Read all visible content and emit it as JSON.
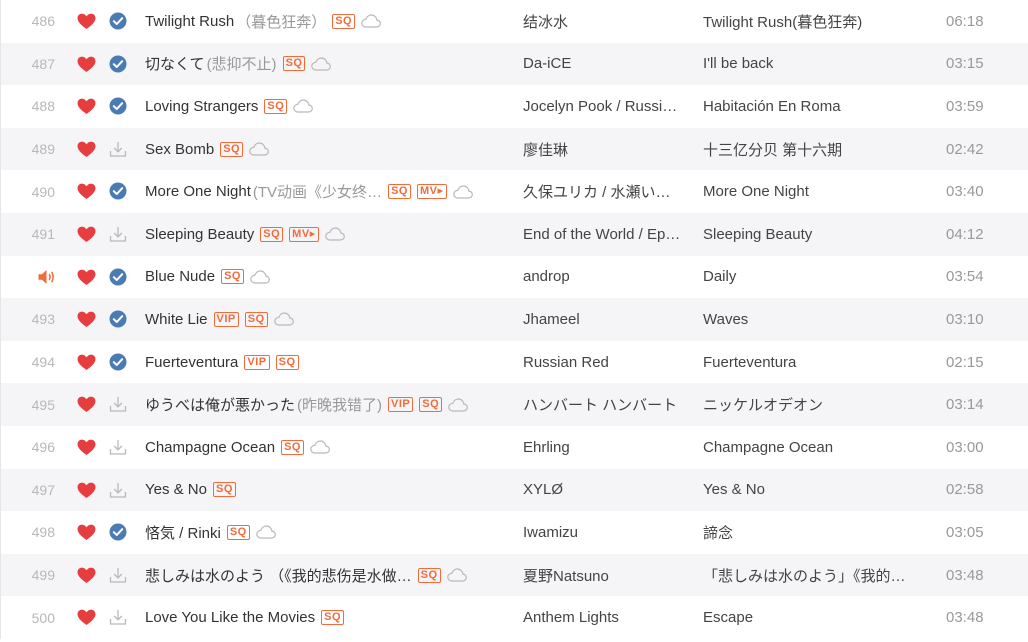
{
  "colors": {
    "accent": "#f26b3a",
    "heart": "#e63e3e",
    "check": "#4a7bb5",
    "muted": "#999999",
    "stripe": "#f5f5f7"
  },
  "rows": [
    {
      "num": "486",
      "status": "downloaded",
      "playing": false,
      "title": "Twilight Rush",
      "alias": "（暮色狂奔）",
      "badges": [
        "SQ"
      ],
      "cloud": true,
      "artist": "结冰水",
      "album": "Twilight Rush(暮色狂奔)",
      "duration": "06:18"
    },
    {
      "num": "487",
      "status": "downloaded",
      "playing": false,
      "title": "切なくて",
      "alias": "(悲抑不止)",
      "badges": [
        "SQ"
      ],
      "cloud": true,
      "artist": "Da-iCE",
      "album": "I'll be back",
      "duration": "03:15"
    },
    {
      "num": "488",
      "status": "downloaded",
      "playing": false,
      "title": "Loving Strangers",
      "alias": "",
      "badges": [
        "SQ"
      ],
      "cloud": true,
      "artist": "Jocelyn Pook / Russi…",
      "album": "Habitación En Roma",
      "duration": "03:59"
    },
    {
      "num": "489",
      "status": "download",
      "playing": false,
      "title": "Sex Bomb",
      "alias": "",
      "badges": [
        "SQ"
      ],
      "cloud": true,
      "artist": "廖佳琳",
      "album": "十三亿分贝 第十六期",
      "duration": "02:42"
    },
    {
      "num": "490",
      "status": "downloaded",
      "playing": false,
      "title": "More One Night",
      "alias": "(TV动画《少女终…",
      "badges": [
        "SQ",
        "MV▸"
      ],
      "cloud": true,
      "artist": "久保ユリカ / 水瀬い…",
      "album": "More One Night",
      "duration": "03:40"
    },
    {
      "num": "491",
      "status": "download",
      "playing": false,
      "title": "Sleeping Beauty",
      "alias": "",
      "badges": [
        "SQ",
        "MV▸"
      ],
      "cloud": true,
      "artist": "End of the World / Ep…",
      "album": "Sleeping Beauty",
      "duration": "04:12"
    },
    {
      "num": "",
      "status": "downloaded",
      "playing": true,
      "title": "Blue Nude",
      "alias": "",
      "badges": [
        "SQ"
      ],
      "cloud": true,
      "artist": "androp",
      "album": "Daily",
      "duration": "03:54"
    },
    {
      "num": "493",
      "status": "downloaded",
      "playing": false,
      "title": "White Lie",
      "alias": "",
      "badges": [
        "VIP",
        "SQ"
      ],
      "cloud": true,
      "artist": "Jhameel",
      "album": "Waves",
      "duration": "03:10"
    },
    {
      "num": "494",
      "status": "downloaded",
      "playing": false,
      "title": "Fuerteventura",
      "alias": "",
      "badges": [
        "VIP",
        "SQ"
      ],
      "cloud": false,
      "artist": "Russian Red",
      "album": "Fuerteventura",
      "duration": "02:15"
    },
    {
      "num": "495",
      "status": "download",
      "playing": false,
      "title": "ゆうべは俺が悪かった",
      "alias": "(昨晚我错了)",
      "badges": [
        "VIP",
        "SQ"
      ],
      "cloud": true,
      "artist": "ハンバート ハンバート",
      "album": "ニッケルオデオン",
      "duration": "03:14"
    },
    {
      "num": "496",
      "status": "download",
      "playing": false,
      "title": "Champagne Ocean",
      "alias": "",
      "badges": [
        "SQ"
      ],
      "cloud": true,
      "artist": "Ehrling",
      "album": "Champagne Ocean",
      "duration": "03:00"
    },
    {
      "num": "497",
      "status": "download",
      "playing": false,
      "title": "Yes & No",
      "alias": "",
      "badges": [
        "SQ"
      ],
      "cloud": false,
      "artist": "XYLØ",
      "album": "Yes & No",
      "duration": "02:58"
    },
    {
      "num": "498",
      "status": "downloaded",
      "playing": false,
      "title": "悋気 / Rinki",
      "alias": "",
      "badges": [
        "SQ"
      ],
      "cloud": true,
      "artist": "Iwamizu",
      "album": "諦念",
      "duration": "03:05"
    },
    {
      "num": "499",
      "status": "download",
      "playing": false,
      "title": "悲しみは水のよう （《我的悲伤是水做…",
      "alias": "",
      "badges": [
        "SQ"
      ],
      "cloud": true,
      "artist": "夏野Natsuno",
      "album": "「悲しみは水のよう」《我的…",
      "duration": "03:48"
    },
    {
      "num": "500",
      "status": "download",
      "playing": false,
      "title": "Love You Like the Movies",
      "alias": "",
      "badges": [
        "SQ"
      ],
      "cloud": false,
      "artist": "Anthem Lights",
      "album": "Escape",
      "duration": "03:48"
    }
  ]
}
